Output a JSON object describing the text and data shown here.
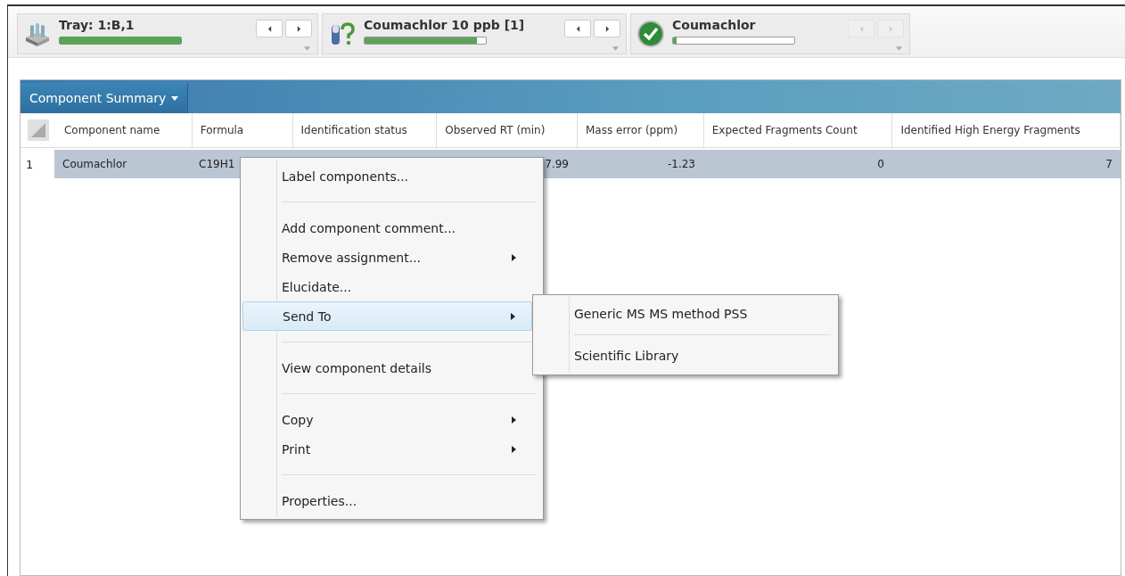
{
  "samples": [
    {
      "title": "Tray: 1:B,1",
      "level": 1.0,
      "disabled": false
    },
    {
      "title": "Coumachlor 10 ppb  [1]",
      "level": 0.93,
      "disabled": false
    },
    {
      "title": "Coumachlor",
      "level": 0.03,
      "disabled": true
    }
  ],
  "panel": {
    "title": "Component Summary"
  },
  "table": {
    "columns": [
      {
        "label": "Component name"
      },
      {
        "label": "Formula"
      },
      {
        "label": "Identification status"
      },
      {
        "label": "Observed RT (min)"
      },
      {
        "label": "Mass error (ppm)"
      },
      {
        "label": "Expected Fragments Count"
      },
      {
        "label": "Identified High Energy Fragments"
      }
    ],
    "rows": [
      {
        "number": "1",
        "selected": true,
        "cells": [
          "Coumachlor",
          "C19H1",
          "",
          "7.99",
          "-1.23",
          "0",
          "7"
        ]
      }
    ]
  },
  "context_menu": {
    "items": [
      {
        "kind": "item",
        "label": "Label components...",
        "submenu": false,
        "selected": false
      },
      {
        "kind": "separator"
      },
      {
        "kind": "item",
        "label": "Add component comment...",
        "submenu": false,
        "selected": false
      },
      {
        "kind": "item",
        "label": "Remove assignment...",
        "submenu": true,
        "selected": false
      },
      {
        "kind": "item",
        "label": "Elucidate...",
        "submenu": false,
        "selected": false
      },
      {
        "kind": "item",
        "label": "Send To",
        "submenu": true,
        "selected": true
      },
      {
        "kind": "separator"
      },
      {
        "kind": "item",
        "label": "View component details",
        "submenu": false,
        "selected": false
      },
      {
        "kind": "separator"
      },
      {
        "kind": "item",
        "label": "Copy",
        "submenu": true,
        "selected": false
      },
      {
        "kind": "item",
        "label": "Print",
        "submenu": true,
        "selected": false
      },
      {
        "kind": "separator"
      },
      {
        "kind": "item",
        "label": "Properties...",
        "submenu": false,
        "selected": false
      }
    ]
  },
  "submenu": {
    "items": [
      {
        "kind": "item",
        "label": "Generic MS MS method PSS"
      },
      {
        "kind": "separator"
      },
      {
        "kind": "item",
        "label": "Scientific Library"
      }
    ]
  }
}
